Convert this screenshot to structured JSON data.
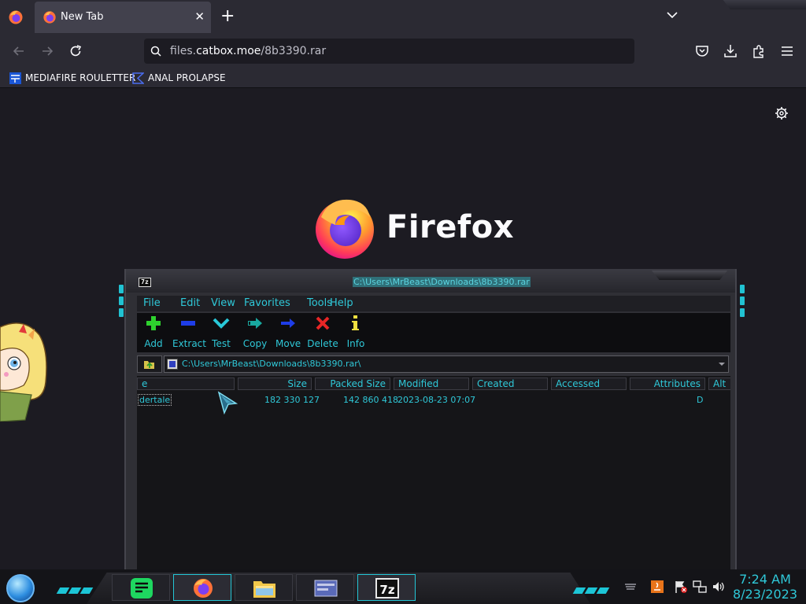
{
  "browser": {
    "tab_title": "New Tab",
    "tab_close_glyph": "✕",
    "new_tab_glyph": "+",
    "url_host": "files.catbox.moe",
    "url_path": "/8b3390.rar",
    "url_prefix": "files.",
    "url_domain": "catbox.moe",
    "bookmarks": [
      {
        "label": "MEDIAFIRE ROULETTER",
        "icon": "mediafire-icon"
      },
      {
        "label": "ANAL PROLAPSE",
        "icon": "bookmark-logo-icon"
      }
    ],
    "brand_word": "Firefox",
    "accent": "#fbfbfe",
    "background": "#1c1b22"
  },
  "sevenzip": {
    "title_icon_label": "7z",
    "title_path": "C:\\Users\\MrBeast\\Downloads\\8b3390.rar",
    "menu": [
      "File",
      "Edit",
      "View",
      "Favorites",
      "Tools",
      "Help"
    ],
    "toolbar": [
      {
        "label": "Add",
        "icon": "add-icon"
      },
      {
        "label": "Extract",
        "icon": "extract-icon"
      },
      {
        "label": "Test",
        "icon": "test-icon"
      },
      {
        "label": "Copy",
        "icon": "copy-icon"
      },
      {
        "label": "Move",
        "icon": "move-icon"
      },
      {
        "label": "Delete",
        "icon": "delete-icon"
      },
      {
        "label": "Info",
        "icon": "info-icon"
      }
    ],
    "address": "C:\\Users\\MrBeast\\Downloads\\8b3390.rar\\",
    "columns": [
      "e",
      "Size",
      "Packed Size",
      "Modified",
      "Created",
      "Accessed",
      "Attributes",
      "Alt"
    ],
    "rows": [
      {
        "name": "dertale",
        "size": "182 330 127",
        "packed": "142 860 418",
        "modified": "2023-08-23 07:07",
        "created": "",
        "accessed": "",
        "attributes": "D"
      }
    ],
    "text_color": "#2fc8d8"
  },
  "taskbar": {
    "time": "7:24 AM",
    "date": "8/23/2023",
    "apps": [
      "notes-app-icon",
      "firefox-icon",
      "file-explorer-icon",
      "control-panel-icon",
      "sevenzip-icon"
    ],
    "sevenzip_label": "7z",
    "accent": "#1cc5d6"
  }
}
